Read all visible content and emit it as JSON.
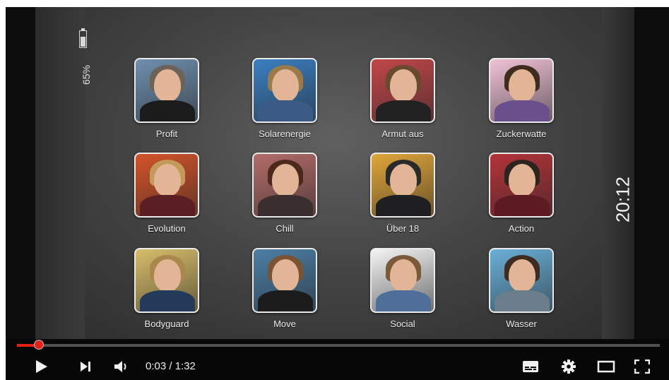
{
  "device": {
    "battery_percent": "65%",
    "battery_level": 0.65,
    "clock": "20:12"
  },
  "grid": [
    {
      "label": "Profit",
      "bg": "#6f8fae",
      "hair": "#6d6258",
      "shirt": "#1b1b1b"
    },
    {
      "label": "Solarenergie",
      "bg": "#3a7fc2",
      "hair": "#9b7a4a",
      "shirt": "#3c5a86"
    },
    {
      "label": "Armut aus",
      "bg": "#c2474a",
      "hair": "#6a4a2e",
      "shirt": "#222222"
    },
    {
      "label": "Zuckerwatte",
      "bg": "#f0c2d6",
      "hair": "#3f2c1e",
      "shirt": "#6a4f8c"
    },
    {
      "label": "Evolution",
      "bg": "#d4542a",
      "hair": "#c49a5a",
      "shirt": "#5a1e24"
    },
    {
      "label": "Chill",
      "bg": "#b36d6a",
      "hair": "#4b2a1c",
      "shirt": "#3a2f2e"
    },
    {
      "label": "Über 18",
      "bg": "#e0a63a",
      "hair": "#2a2a2a",
      "shirt": "#1f1f22"
    },
    {
      "label": "Action",
      "bg": "#b3343a",
      "hair": "#2e241e",
      "shirt": "#5e1a22"
    },
    {
      "label": "Bodyguard",
      "bg": "#d8be6a",
      "hair": "#a9874d",
      "shirt": "#243a5a"
    },
    {
      "label": "Move",
      "bg": "#4c7fa6",
      "hair": "#7a5432",
      "shirt": "#1c1c1c"
    },
    {
      "label": "Social",
      "bg": "#f4f4f4",
      "hair": "#7a5a3a",
      "shirt": "#4e6f9a"
    },
    {
      "label": "Wasser",
      "bg": "#6ab0d8",
      "hair": "#3e2c22",
      "shirt": "#6a7e8c"
    }
  ],
  "player": {
    "time_display": "0:03 / 1:32",
    "progress": 0.034,
    "accent_color": "#e62117",
    "icons": {
      "play": "play-icon",
      "next": "next-icon",
      "volume": "volume-icon",
      "subtitles": "subtitles-icon",
      "settings": "settings-icon",
      "theater": "theater-mode-icon",
      "fullscreen": "fullscreen-icon"
    }
  }
}
